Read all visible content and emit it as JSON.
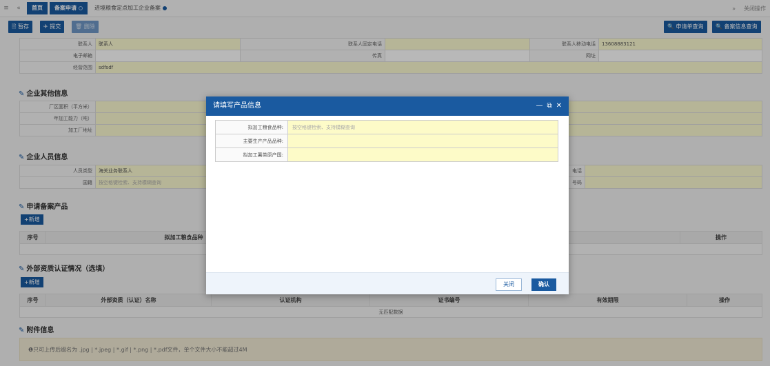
{
  "tabbar": {
    "menu_icon": "≡",
    "prev_icon": "«",
    "tabs": [
      {
        "label": "首页"
      },
      {
        "label": "备案申请"
      },
      {
        "label": "进境粮食定点加工企业备案"
      }
    ],
    "next_icon": "»",
    "close_ops": "关闭操作"
  },
  "toolbar": {
    "save": "暂存",
    "submit": "提交",
    "delete": "删除",
    "query_app": "申请单查询",
    "query_record": "备案信息查询"
  },
  "contact": {
    "contact_label": "联系人",
    "contact_value": "联系人",
    "phone_label": "联系人固定电话",
    "phone_value": "",
    "mobile_label": "联系人移动电话",
    "mobile_value": "13608883121",
    "email_label": "电子邮箱",
    "fax_label": "传真",
    "website_label": "网址",
    "scope_label": "经营范围",
    "scope_value": "sdfsdf"
  },
  "other_info": {
    "title": "企业其他信息",
    "area_label": "厂区面积（平方米）",
    "capacity_label": "年加工能力（吨）",
    "address_label": "加工厂地址",
    "hidden_suffix": "吨)"
  },
  "staff_info": {
    "title": "企业人员信息",
    "type_label": "人员类型",
    "type_value": "海关业务联系人",
    "country_label": "国籍",
    "country_placeholder": "按空格键检索、支持模糊查询",
    "phone_suffix": "电话",
    "id_suffix": "号码"
  },
  "products": {
    "title": "申请备案产品",
    "add": "+新增",
    "col_no": "序号",
    "col_variety": "拟加工粮食品种",
    "col_origin": "加工薯类原产国",
    "col_op": "操作"
  },
  "certs": {
    "title": "外部资质认证情况（选填）",
    "add": "+新增",
    "col_no": "序号",
    "col_name": "外部资质（认证）名称",
    "col_org": "认证机构",
    "col_number": "证书编号",
    "col_valid": "有效期限",
    "col_op": "操作",
    "empty": "无匹配数据"
  },
  "attachments": {
    "title": "附件信息",
    "notice": "❶只可上传后缀名为 .jpg | *.jpeg | *.gif | *.png | *.pdf文件，单个文件大小不能超过4M"
  },
  "modal": {
    "title": "请填写产品信息",
    "minimize": "—",
    "maximize": "⧉",
    "close": "✕",
    "fields": [
      {
        "label": "拟加工粮食品种:",
        "value": "按空格键检索、支持模糊查询"
      },
      {
        "label": "主要生产产品品种:",
        "value": ""
      },
      {
        "label": "拟加工薯类原产国:",
        "value": ""
      }
    ],
    "close_btn": "关闭",
    "ok_btn": "确认"
  },
  "colors": {
    "primary": "#1a5aa0",
    "field_yellow": "#fdfbd2"
  }
}
